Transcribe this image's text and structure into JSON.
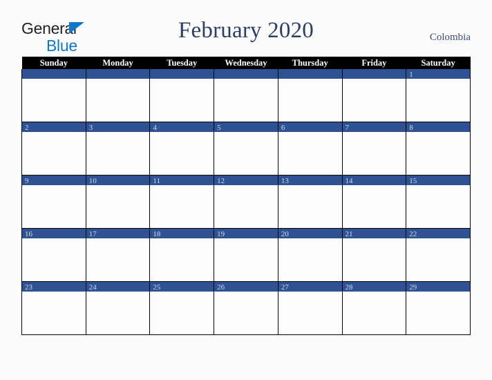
{
  "brand": {
    "name_part1": "General",
    "name_part2": "Blue",
    "triangle_color": "#1277c4",
    "text_color": "#231f20"
  },
  "header": {
    "title": "February 2020",
    "country": "Colombia",
    "title_color": "#2b3f66"
  },
  "calendar": {
    "month": "February",
    "year": "2020",
    "accent_color": "#2e5293",
    "header_bg": "#000000",
    "weekdays": [
      "Sunday",
      "Monday",
      "Tuesday",
      "Wednesday",
      "Thursday",
      "Friday",
      "Saturday"
    ],
    "weeks": [
      [
        "",
        "",
        "",
        "",
        "",
        "",
        "1"
      ],
      [
        "2",
        "3",
        "4",
        "5",
        "6",
        "7",
        "8"
      ],
      [
        "9",
        "10",
        "11",
        "12",
        "13",
        "14",
        "15"
      ],
      [
        "16",
        "17",
        "18",
        "19",
        "20",
        "21",
        "22"
      ],
      [
        "23",
        "24",
        "25",
        "26",
        "27",
        "28",
        "29"
      ]
    ]
  }
}
